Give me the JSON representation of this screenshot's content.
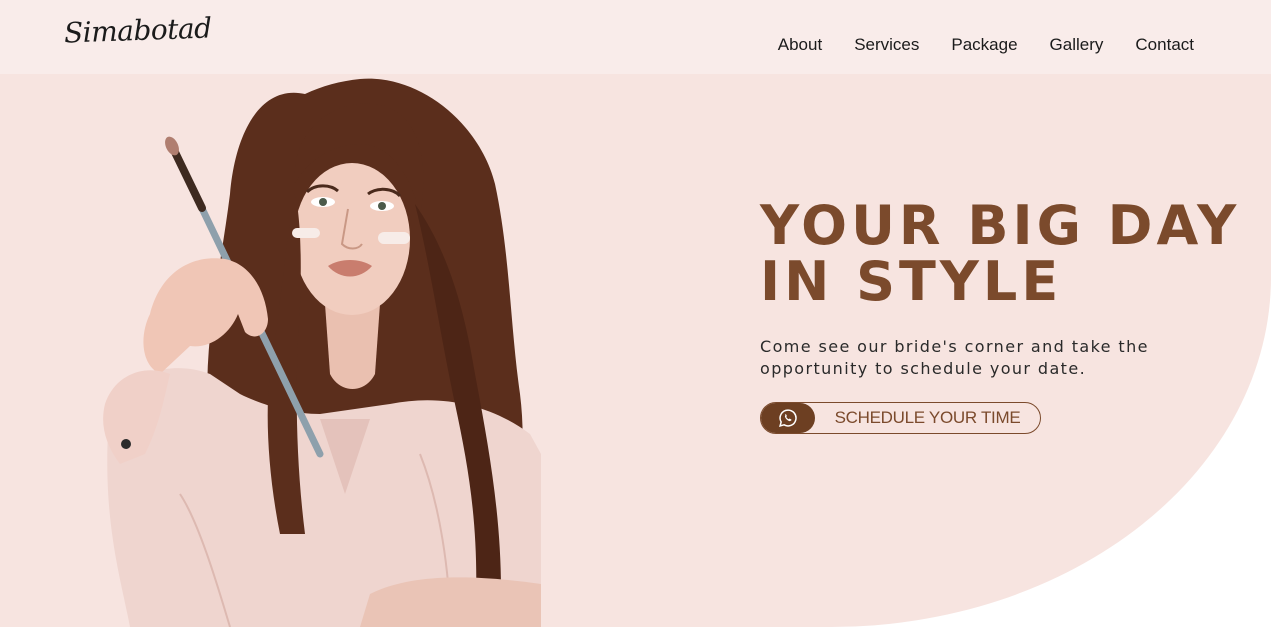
{
  "brand": {
    "logo_text": "Simabotad"
  },
  "nav": {
    "items": [
      "About",
      "Services",
      "Package",
      "Gallery",
      "Contact"
    ]
  },
  "hero": {
    "headline_line1": "YOUR BIG DAY",
    "headline_line2": "IN STYLE",
    "subtitle": "Come see our bride's corner and take the opportunity to schedule your date.",
    "cta_label": "SCHEDULE YOUR TIME",
    "cta_icon": "whatsapp-icon",
    "image_alt": "woman-holding-makeup-brush"
  },
  "colors": {
    "header_bg": "#f9ecea",
    "hero_bg": "#f7e4e0",
    "accent": "#7b4a2c",
    "accent_dark": "#6d3f22",
    "text": "#1b1b1b"
  }
}
